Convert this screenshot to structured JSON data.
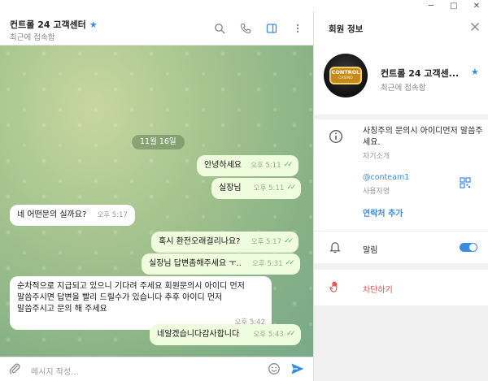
{
  "window": {
    "minimize": "─",
    "maximize": "□",
    "close": "✕"
  },
  "chat": {
    "title": "컨트롤 24 고객센터",
    "status": "최근에 접속함",
    "date_divider": "11월 16일",
    "messages": [
      {
        "dir": "out",
        "text": "안녕하세요",
        "time": "오후 5:11",
        "read": true
      },
      {
        "dir": "out",
        "text": "실장님",
        "time": "오후 5:11",
        "read": true
      },
      {
        "dir": "in",
        "text": "네 어떤문의 실까요?",
        "time": "오후 5:17"
      },
      {
        "dir": "out",
        "text": "혹시 환전오래걸리나요?",
        "time": "오후 5:17",
        "read": true
      },
      {
        "dir": "out",
        "text": "실장님 답변좀해주세요 ㅜ..",
        "time": "오후 5:31",
        "read": true
      },
      {
        "dir": "in",
        "text": "순차적으로 지급되고 있으니 기다려 주세요 회원문의시 아이디 먼저\n말씀주시면 답변을 빨리 드릴수가 있습니다 추후 아이디 먼저\n말씀주시고 문의 해 주세요",
        "time": "오후 5:42"
      },
      {
        "dir": "out",
        "text": "네알겠습니다감사합니다",
        "time": "오후 5:43",
        "read": true
      }
    ],
    "composer_placeholder": "메시지 작성..."
  },
  "info": {
    "title": "회원 정보",
    "profile": {
      "name": "컨트롤 24 고객센...",
      "status": "최근에 접속함",
      "avatar_text": "CONTROL",
      "avatar_subtext": "CASINO"
    },
    "bio": "사칭주의 문의시 아이디먼저 말씀주세요.",
    "bio_label": "자기소개",
    "username": "@conteam1",
    "username_label": "사용자명",
    "add_contact": "연락처 추가",
    "notifications_label": "알림",
    "notifications_on": true,
    "block_label": "차단하기"
  },
  "colors": {
    "accent": "#3a8dde",
    "danger": "#e0524a",
    "out_bubble": "#effdde"
  }
}
